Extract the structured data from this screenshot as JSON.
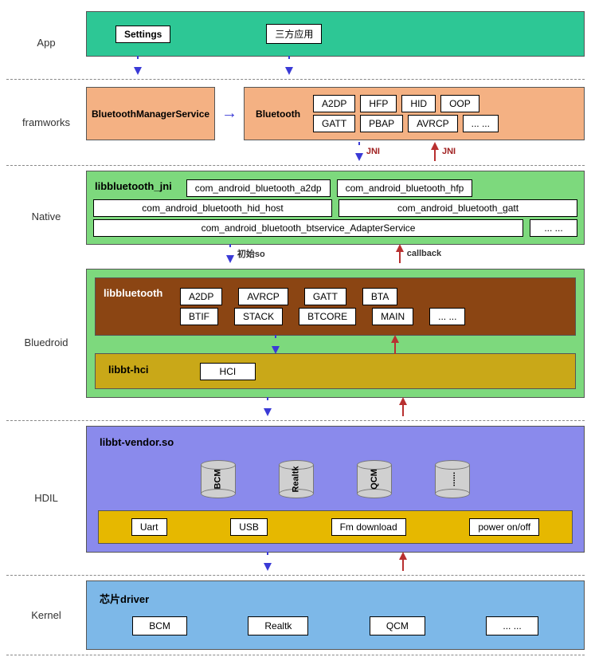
{
  "layers": {
    "app": {
      "label": "App",
      "settings": "Settings",
      "thirdparty": "三方应用"
    },
    "frameworks": {
      "label": "framworks",
      "bms": "BluetoothManagerService",
      "bt": "Bluetooth",
      "profiles": [
        "A2DP",
        "HFP",
        "HID",
        "OOP",
        "GATT",
        "PBAP",
        "AVRCP",
        "... ..."
      ]
    },
    "native": {
      "label": "Native",
      "title": "libbluetooth_jni",
      "items": [
        "com_android_bluetooth_a2dp",
        "com_android_bluetooth_hfp",
        "com_android_bluetooth_hid_host",
        "com_android_bluetooth_gatt",
        "com_android_bluetooth_btservice_AdapterService",
        "... ..."
      ],
      "jni": "JNI"
    },
    "bluedroid": {
      "label": "Bluedroid",
      "lib_title": "libbluetooth",
      "init": "初始so",
      "callback": "callback",
      "lib_items": [
        "A2DP",
        "AVRCP",
        "GATT",
        "BTA",
        "BTIF",
        "STACK",
        "BTCORE",
        "MAIN",
        "... ..."
      ],
      "hci_title": "libbt-hci",
      "hci": "HCI"
    },
    "hdil": {
      "label": "HDIL",
      "title": "libbt-vendor.so",
      "cylinders": [
        "BCM",
        "Realtk",
        "QCM",
        "......"
      ],
      "transports": [
        "Uart",
        "USB",
        "Fm download",
        "power on/off"
      ]
    },
    "kernel": {
      "label": "Kernel",
      "title": "芯片driver",
      "chips": [
        "BCM",
        "Realtk",
        "QCM",
        "... ..."
      ]
    }
  }
}
